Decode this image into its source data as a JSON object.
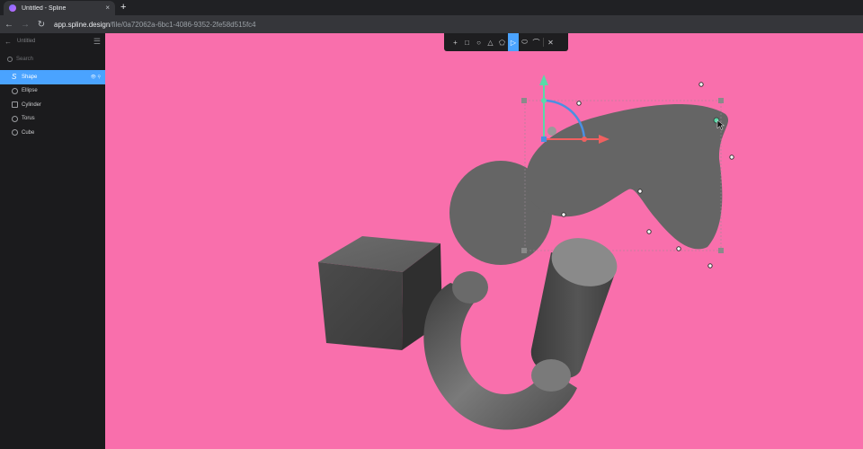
{
  "browser": {
    "tab_title": "Untitled - Spline",
    "tab_close": "×",
    "new_tab": "+",
    "back": "←",
    "forward": "→",
    "reload": "↻",
    "url_host": "app.spline.design",
    "url_path": "/file/0a72062a-6bc1-4086-9352-2fe58d515fc4"
  },
  "sidebar": {
    "title": "Untitled",
    "search_placeholder": "Search",
    "items": [
      {
        "label": "Shape",
        "selected": true,
        "icon": "pen-shape-icon"
      },
      {
        "label": "Ellipse",
        "icon": "ellipse-icon"
      },
      {
        "label": "Cylinder",
        "icon": "cylinder-icon"
      },
      {
        "label": "Torus",
        "icon": "torus-icon"
      },
      {
        "label": "Cube",
        "icon": "cube-icon"
      }
    ],
    "item_actions": "👁 ⚲"
  },
  "toolbar": {
    "tools": [
      "+",
      "□",
      "○",
      "△",
      "⬠",
      "▷",
      "⬭",
      "⌒",
      "✕"
    ]
  },
  "colors": {
    "canvas_bg": "#f96fac",
    "object_gray": "#656565",
    "selection_blue": "#4aa3ff",
    "gizmo_green": "#5ad9a8",
    "gizmo_red": "#f06060"
  }
}
